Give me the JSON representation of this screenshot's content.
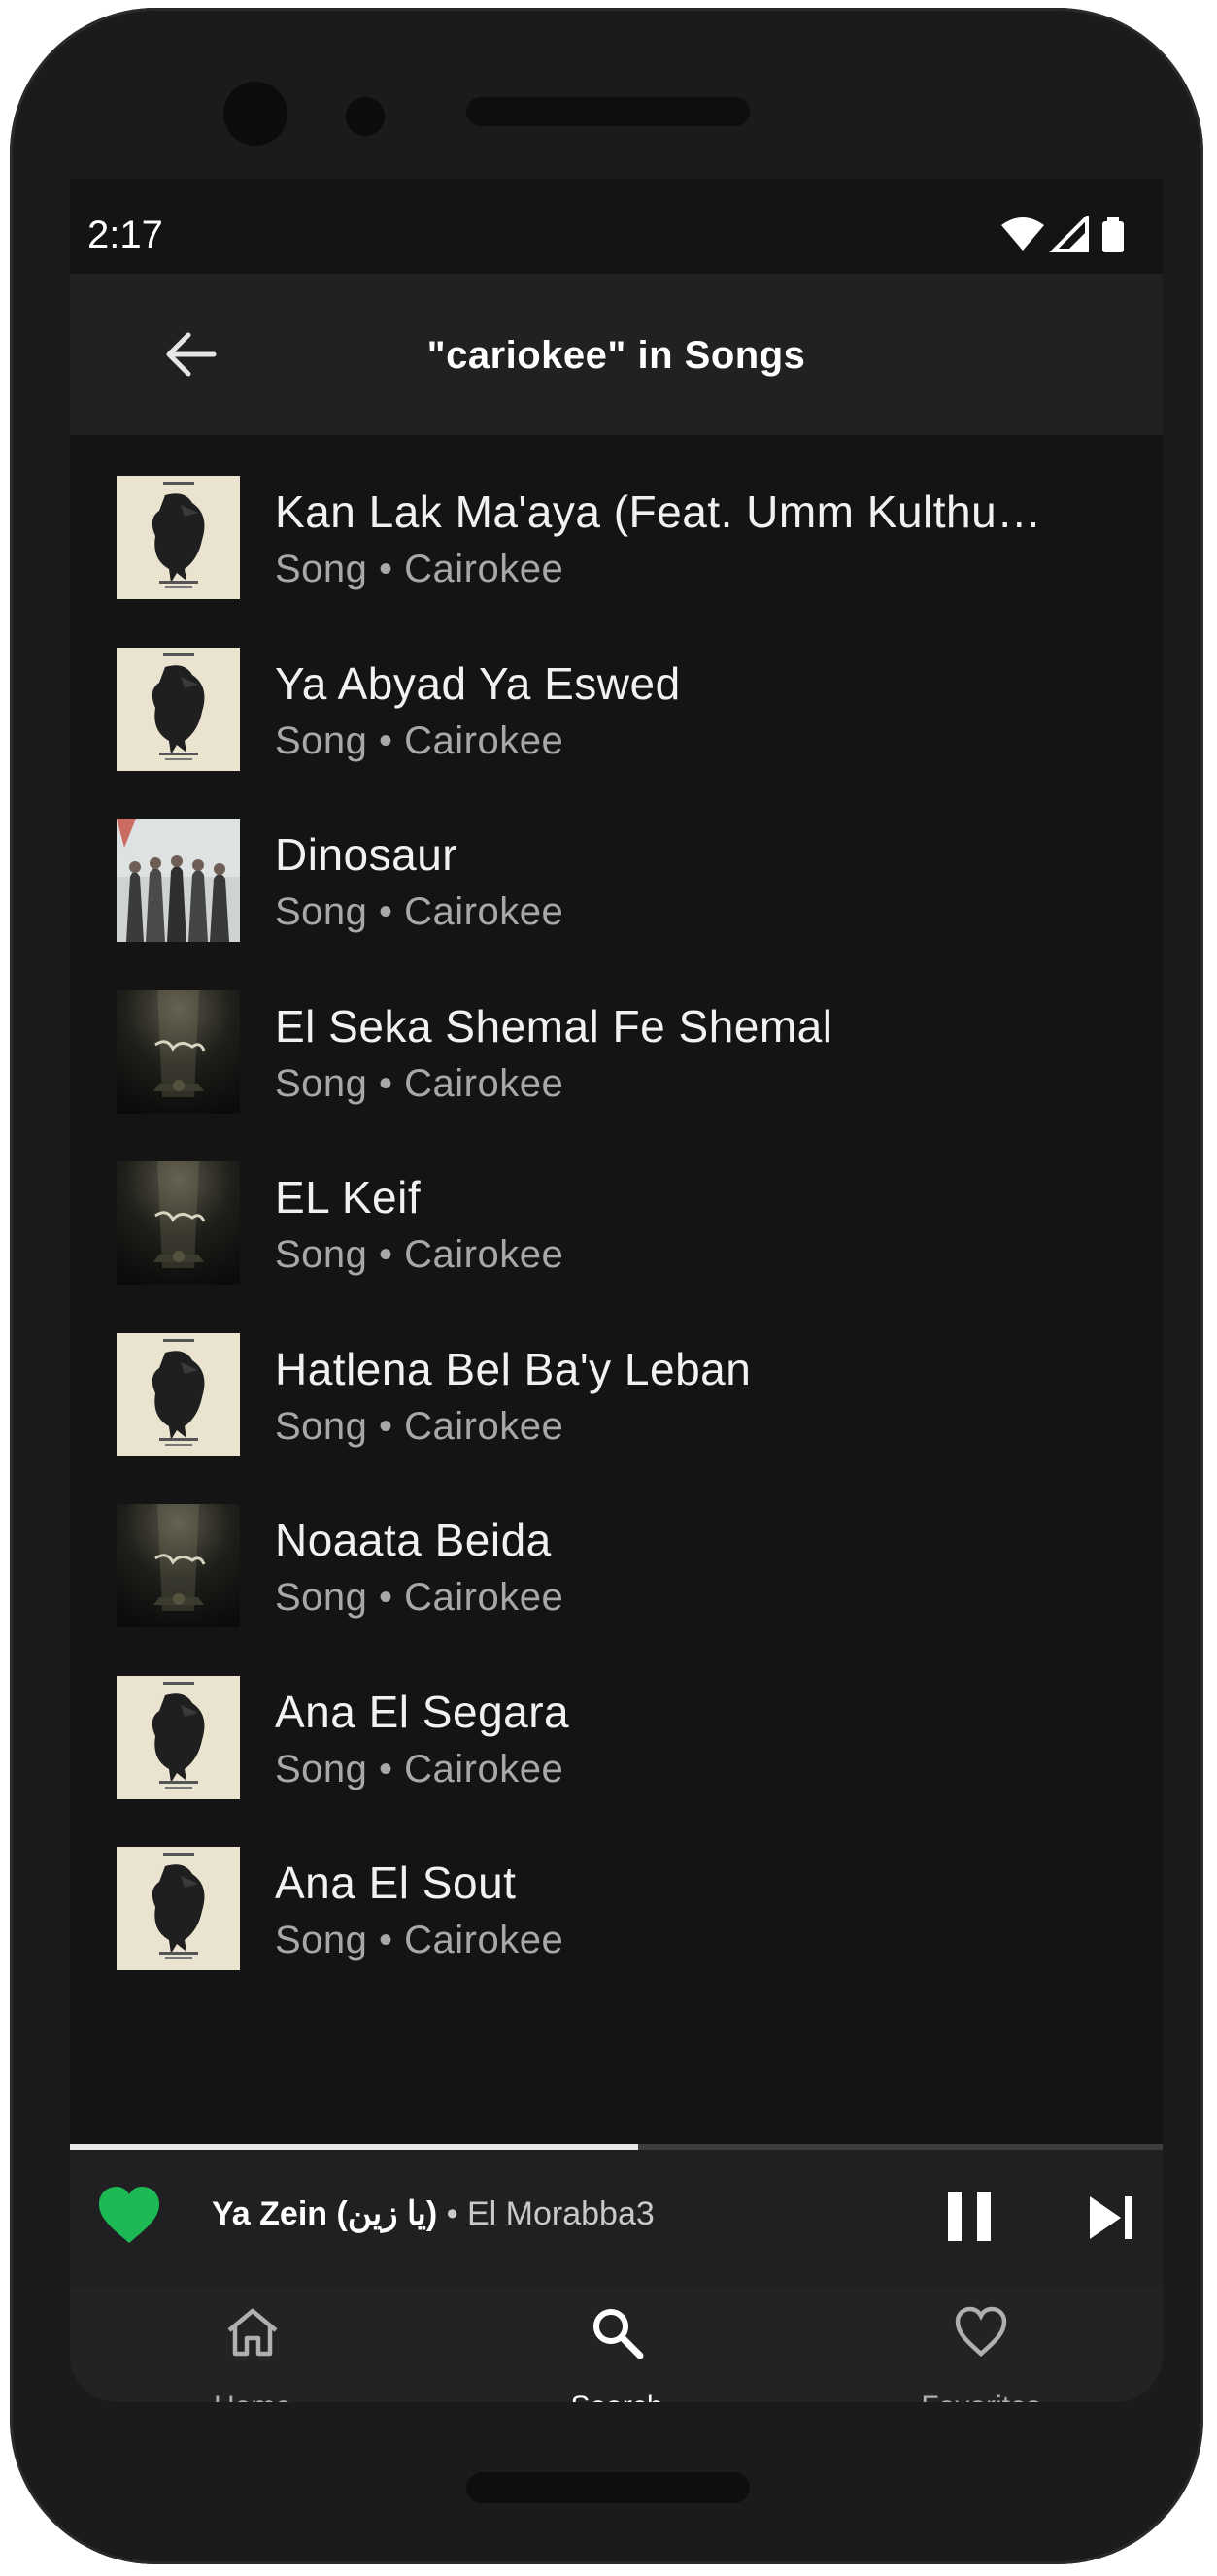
{
  "status_bar": {
    "time": "2:17"
  },
  "app_bar": {
    "title": "\"cariokee\" in Songs"
  },
  "songs": [
    {
      "title": "Kan Lak Ma'aya (Feat. Umm Kulthu…",
      "subtitle": "Song • Cairokee",
      "art": "bird"
    },
    {
      "title": "Ya Abyad Ya Eswed",
      "subtitle": "Song • Cairokee",
      "art": "bird"
    },
    {
      "title": "Dinosaur",
      "subtitle": "Song • Cairokee",
      "art": "band"
    },
    {
      "title": "El Seka Shemal Fe Shemal",
      "subtitle": "Song • Cairokee",
      "art": "dark"
    },
    {
      "title": "EL Keif",
      "subtitle": "Song • Cairokee",
      "art": "dark"
    },
    {
      "title": "Hatlena Bel Ba'y Leban",
      "subtitle": "Song • Cairokee",
      "art": "bird"
    },
    {
      "title": "Noaata Beida",
      "subtitle": "Song • Cairokee",
      "art": "dark"
    },
    {
      "title": "Ana El Segara",
      "subtitle": "Song • Cairokee",
      "art": "bird"
    },
    {
      "title": "Ana El Sout",
      "subtitle": "Song • Cairokee",
      "art": "bird"
    }
  ],
  "player": {
    "title": "Ya Zein (يا زين)",
    "separator": " • ",
    "artist": "El Morabba3",
    "progress": 0.52,
    "favorite": true,
    "favorite_color": "#1db954"
  },
  "nav": {
    "home_label": "Home",
    "search_label": "Search",
    "favorites_label": "Favorites",
    "active": "search"
  },
  "colors": {
    "background": "#141414",
    "bar": "#212124",
    "text_primary": "#f1f1f1",
    "text_secondary": "#a8a8a8"
  }
}
